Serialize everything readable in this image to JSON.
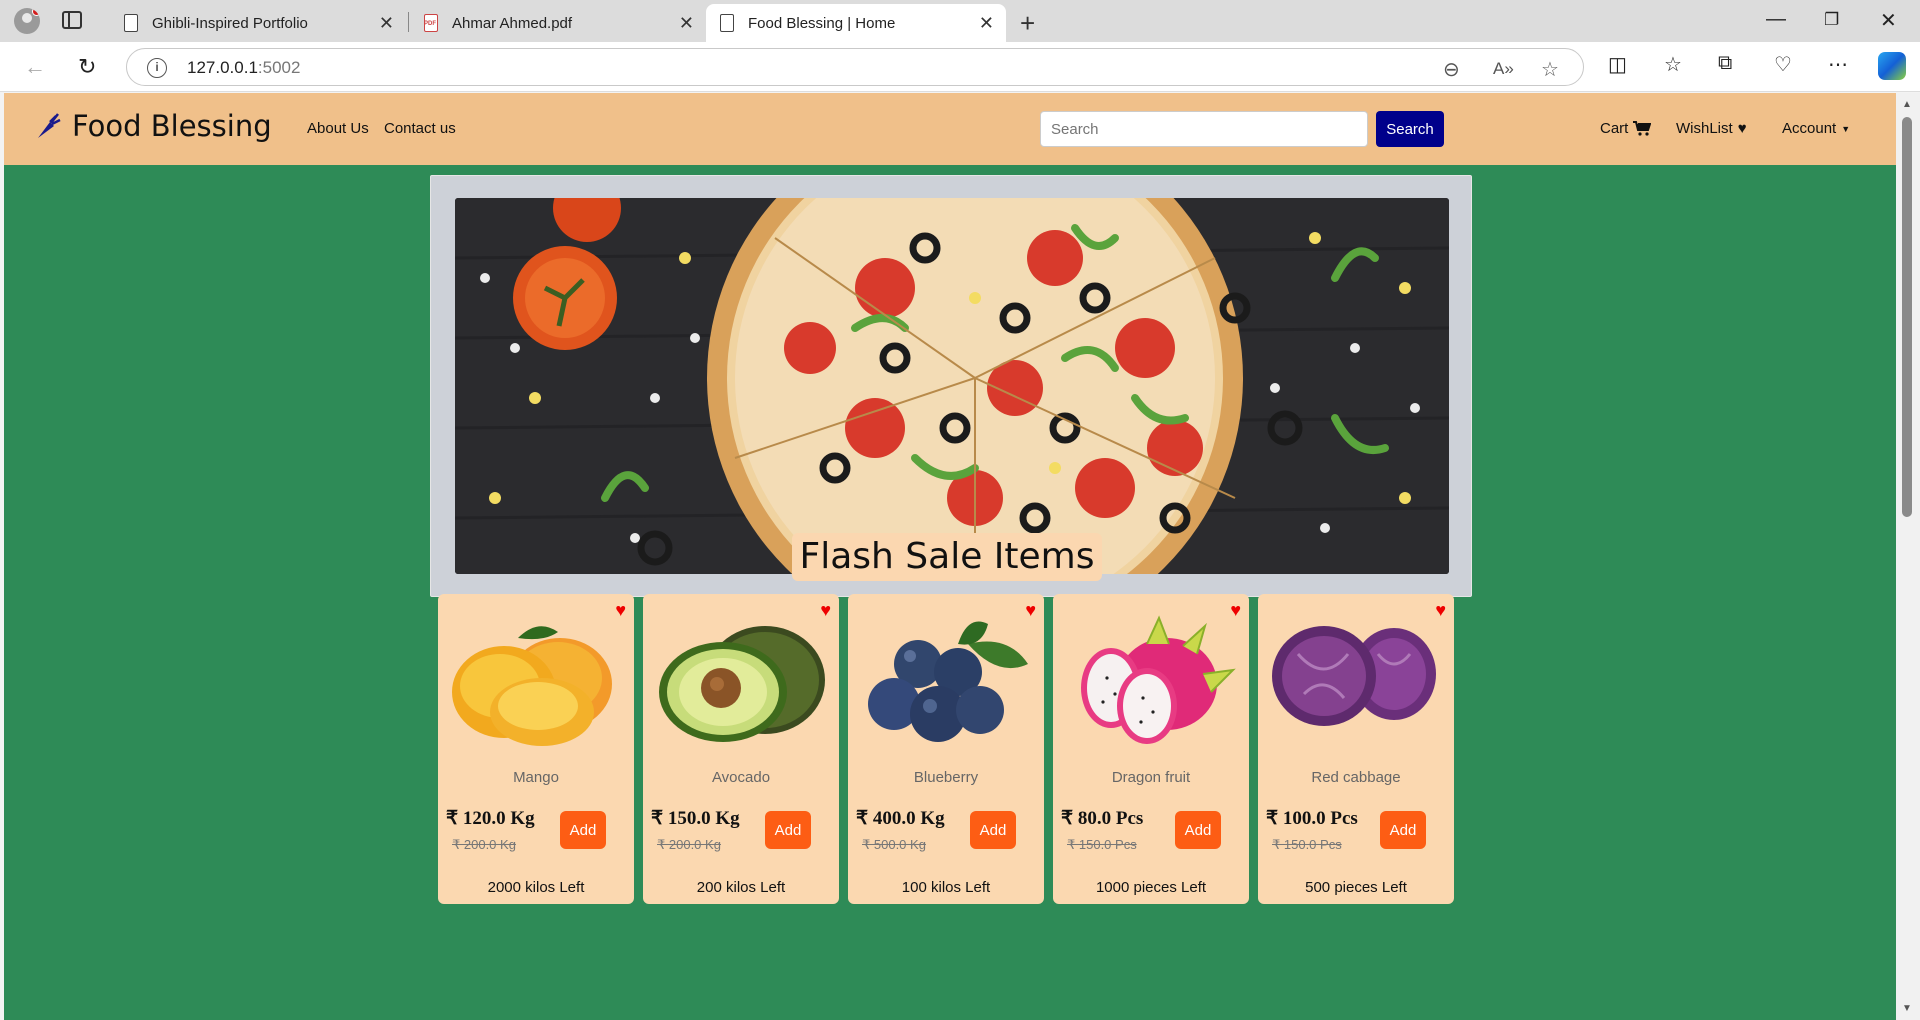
{
  "browser": {
    "tabs": [
      {
        "title": "Ghibli-Inspired Portfolio"
      },
      {
        "title": "Ahmar Ahmed.pdf"
      },
      {
        "title": "Food Blessing | Home"
      }
    ],
    "url_host": "127.0.0.1",
    "url_port": ":5002"
  },
  "nav": {
    "brand": "Food Blessing",
    "links": [
      "About Us",
      "Contact us"
    ],
    "search_placeholder": "Search",
    "search_button": "Search",
    "cart": "Cart",
    "wishlist": "WishList",
    "account": "Account"
  },
  "carousel": {
    "indicator_count": 3,
    "active_index": 0
  },
  "flash": {
    "title": "Flash Sale Items",
    "add_label": "Add",
    "items": [
      {
        "name": "Mango",
        "price": "₹ 120.0 Kg",
        "old_price": "₹ 200.0 Kg",
        "left": "2000 kilos Left"
      },
      {
        "name": "Avocado",
        "price": "₹ 150.0 Kg",
        "old_price": "₹ 200.0 Kg",
        "left": "200 kilos Left"
      },
      {
        "name": "Blueberry",
        "price": "₹ 400.0 Kg",
        "old_price": "₹ 500.0 Kg",
        "left": "100 kilos Left"
      },
      {
        "name": "Dragon fruit",
        "price": "₹ 80.0 Pcs",
        "old_price": "₹ 150.0 Pcs",
        "left": "1000 pieces Left"
      },
      {
        "name": "Red cabbage",
        "price": "₹ 100.0 Pcs",
        "old_price": "₹ 150.0 Pcs",
        "left": "500 pieces Left"
      }
    ]
  },
  "colors": {
    "page_bg": "#2e8b57",
    "navbar": "#f0c08a",
    "search_btn": "#00008b",
    "add_btn": "#fd5d14",
    "card": "#fbd8b0"
  }
}
